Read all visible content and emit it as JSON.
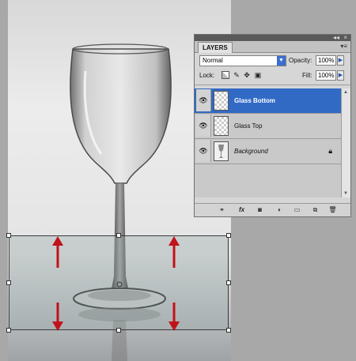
{
  "panel": {
    "tab_label": "LAYERS",
    "collapse_label": "◂◂",
    "close_label": "×",
    "menu_label": "▾≡",
    "blend_mode": "Normal",
    "opacity_label": "Opacity:",
    "opacity_value": "100%",
    "lock_label": "Lock:",
    "fill_label": "Fill:",
    "fill_value": "100%"
  },
  "lock_icons": [
    "lock-transparent-icon",
    "lock-brush-icon",
    "lock-move-icon",
    "lock-all-icon"
  ],
  "layers": [
    {
      "name": "Glass Bottom",
      "selected": true,
      "visible": true
    },
    {
      "name": "Glass Top",
      "selected": false,
      "visible": true
    },
    {
      "name": "Background",
      "selected": false,
      "visible": true,
      "locked": true
    }
  ],
  "bottom_icons": [
    "link-layers-icon",
    "layer-style-fx-icon",
    "layer-mask-icon",
    "adjustment-layer-icon",
    "new-group-icon",
    "new-layer-icon",
    "trash-icon"
  ],
  "colors": {
    "selection_blue": "#316ac5",
    "arrow_red": "#c0131a"
  }
}
